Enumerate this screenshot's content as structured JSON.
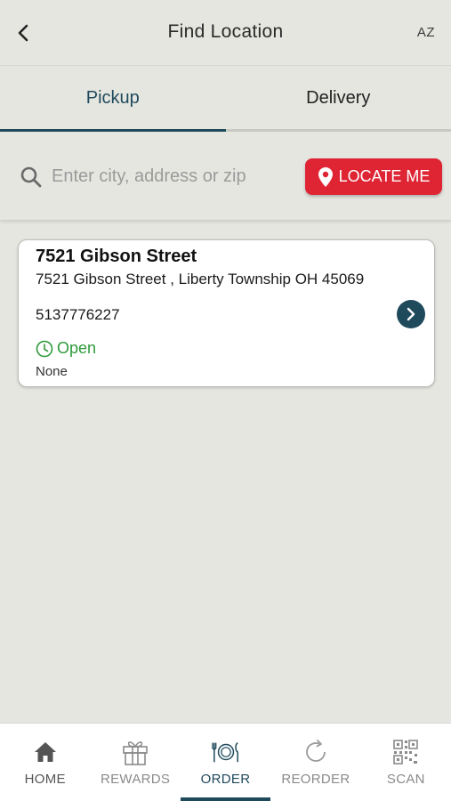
{
  "header": {
    "title": "Find Location",
    "right_label": "AZ"
  },
  "tabs": [
    {
      "label": "Pickup",
      "active": true
    },
    {
      "label": "Delivery",
      "active": false
    }
  ],
  "search": {
    "placeholder": "Enter city, address or zip",
    "value": "",
    "locate_label": "LOCATE ME"
  },
  "location": {
    "name": "7521 Gibson Street",
    "address": "7521 Gibson Street , Liberty Township OH 45069",
    "phone": "5137776227",
    "status": "Open",
    "note": "None"
  },
  "nav": {
    "items": [
      {
        "label": "HOME",
        "icon": "home-icon"
      },
      {
        "label": "REWARDS",
        "icon": "gift-icon"
      },
      {
        "label": "ORDER",
        "icon": "plate-icon",
        "active": true
      },
      {
        "label": "REORDER",
        "icon": "refresh-icon"
      },
      {
        "label": "SCAN",
        "icon": "qr-code-icon"
      }
    ]
  },
  "colors": {
    "accent": "#1f4a5c",
    "locate_button": "#df2533",
    "open_status": "#2e9b3c",
    "background": "#e6e6e1"
  }
}
